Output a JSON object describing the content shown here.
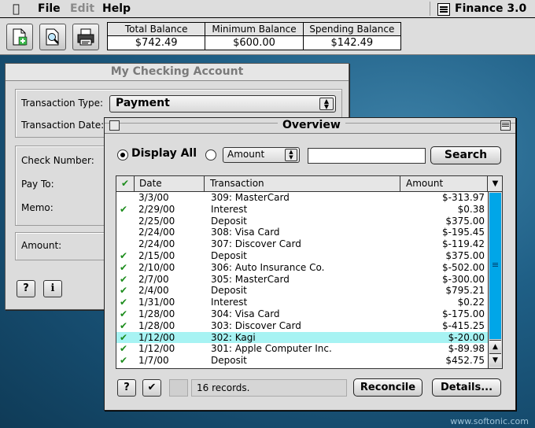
{
  "menubar": {
    "items": [
      "File",
      "Edit",
      "Help"
    ],
    "app_name": "Finance 3.0"
  },
  "balances": [
    {
      "label": "Total Balance",
      "value": "$742.49"
    },
    {
      "label": "Minimum Balance",
      "value": "$600.00"
    },
    {
      "label": "Spending Balance",
      "value": "$142.49"
    }
  ],
  "checking": {
    "title": "My Checking Account",
    "transaction_type_label": "Transaction Type:",
    "transaction_type_value": "Payment",
    "transaction_date_label": "Transaction Date:",
    "check_number_label": "Check Number:",
    "pay_to_label": "Pay To:",
    "memo_label": "Memo:",
    "amount_label": "Amount:",
    "help_label": "?",
    "info_label": "i"
  },
  "overview": {
    "title": "Overview",
    "display_all_label": "Display All",
    "filter_field": "Amount",
    "search_value": "",
    "search_label": "Search",
    "columns": [
      "Date",
      "Transaction",
      "Amount"
    ],
    "rows": [
      {
        "check": false,
        "date": "3/3/00",
        "transaction": "309: MasterCard",
        "amount": "$-313.97"
      },
      {
        "check": true,
        "date": "2/29/00",
        "transaction": "Interest",
        "amount": "$0.38"
      },
      {
        "check": false,
        "date": "2/25/00",
        "transaction": "Deposit",
        "amount": "$375.00"
      },
      {
        "check": false,
        "date": "2/24/00",
        "transaction": "308: Visa Card",
        "amount": "$-195.45"
      },
      {
        "check": false,
        "date": "2/24/00",
        "transaction": "307: Discover Card",
        "amount": "$-119.42"
      },
      {
        "check": true,
        "date": "2/15/00",
        "transaction": "Deposit",
        "amount": "$375.00"
      },
      {
        "check": true,
        "date": "2/10/00",
        "transaction": "306: Auto Insurance Co.",
        "amount": "$-502.00"
      },
      {
        "check": true,
        "date": "2/7/00",
        "transaction": "305: MasterCard",
        "amount": "$-300.00"
      },
      {
        "check": true,
        "date": "2/4/00",
        "transaction": "Deposit",
        "amount": "$795.21"
      },
      {
        "check": true,
        "date": "1/31/00",
        "transaction": "Interest",
        "amount": "$0.22"
      },
      {
        "check": true,
        "date": "1/28/00",
        "transaction": "304: Visa Card",
        "amount": "$-175.00"
      },
      {
        "check": true,
        "date": "1/28/00",
        "transaction": "303: Discover Card",
        "amount": "$-415.25"
      },
      {
        "check": true,
        "date": "1/12/00",
        "transaction": "302: Kagi",
        "amount": "$-20.00",
        "selected": true
      },
      {
        "check": true,
        "date": "1/12/00",
        "transaction": "301: Apple Computer Inc.",
        "amount": "$-89.98"
      },
      {
        "check": true,
        "date": "1/7/00",
        "transaction": "Deposit",
        "amount": "$452.75"
      }
    ],
    "help_label": "?",
    "status_text": "16 records.",
    "reconcile_label": "Reconcile",
    "details_label": "Details..."
  },
  "watermark": "www.softonic.com"
}
